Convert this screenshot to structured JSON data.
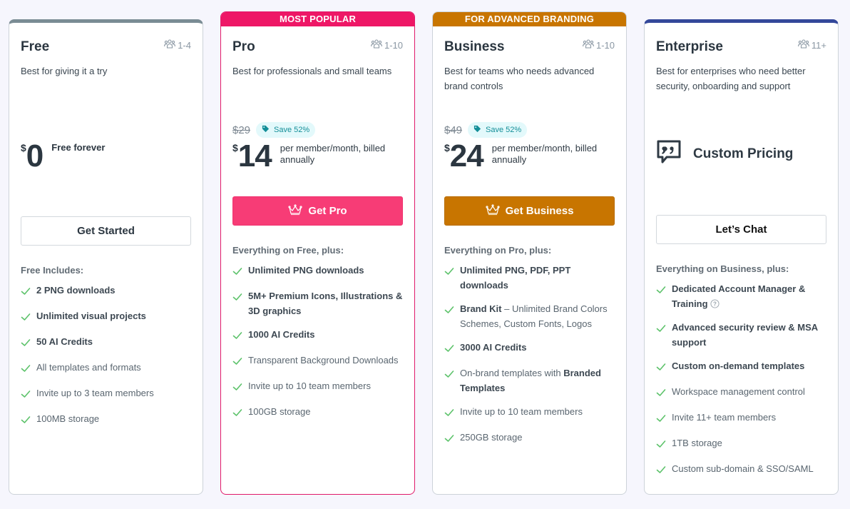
{
  "colors": {
    "page_bg": "#f6f6fd",
    "free_accent": "#7a8c94",
    "pro_accent": "#ee1766",
    "pro_button": "#f73c76",
    "business_accent": "#c87500",
    "enterprise_accent": "#34489a",
    "check": "#5cc26a",
    "save_pill_bg": "#e3f9fb",
    "save_pill_text": "#138e98"
  },
  "plans": [
    {
      "id": "free",
      "name": "Free",
      "team_icon": "team-icon",
      "team_size": "1-4",
      "description": "Best for giving it a try",
      "currency": "$",
      "amount": "0",
      "price_note": "Free forever",
      "cta": "Get Started",
      "features_title": "Free Includes:",
      "features": [
        {
          "text": "2 PNG downloads",
          "strong": true
        },
        {
          "text": "Unlimited visual projects",
          "strong": true
        },
        {
          "text": "50 AI Credits",
          "strong": true
        },
        {
          "text": "All templates and formats",
          "strong": false
        },
        {
          "text": "Invite up to 3 team members",
          "strong": false
        },
        {
          "text": "100MB storage",
          "strong": false
        }
      ]
    },
    {
      "id": "pro",
      "banner": "MOST POPULAR",
      "name": "Pro",
      "team_size": "1-10",
      "description": "Best for professionals and small teams",
      "old_price": "$29",
      "save_label": "Save 52%",
      "currency": "$",
      "amount": "14",
      "price_note": "per member/month, billed annually",
      "cta_icon": "crown-icon",
      "cta": "Get Pro",
      "features_title": "Everything on Free, plus:",
      "features": [
        {
          "text": "Unlimited PNG downloads",
          "strong": true
        },
        {
          "text": "5M+ Premium Icons, Illustrations & 3D graphics",
          "strong": true
        },
        {
          "text": "1000 AI Credits",
          "strong": true
        },
        {
          "text": "Transparent Background Downloads",
          "strong": false
        },
        {
          "text": "Invite up to 10 team members",
          "strong": false
        },
        {
          "text": "100GB storage",
          "strong": false
        }
      ]
    },
    {
      "id": "business",
      "banner": "FOR ADVANCED BRANDING",
      "name": "Business",
      "team_size": "1-10",
      "description": "Best for teams who needs advanced brand controls",
      "old_price": "$49",
      "save_label": "Save 52%",
      "currency": "$",
      "amount": "24",
      "price_note": "per member/month, billed annually",
      "cta_icon": "crown-icon",
      "cta": "Get Business",
      "features_title": "Everything on Pro, plus:",
      "features": [
        {
          "text": "Unlimited PNG, PDF, PPT downloads",
          "strong": true
        },
        {
          "bold": "Brand Kit",
          "text": " – Unlimited Brand Colors Schemes, Custom Fonts, Logos",
          "strong": false
        },
        {
          "text": "3000 AI Credits",
          "strong": true
        },
        {
          "text": "On-brand templates with ",
          "bold_after": "Branded Templates",
          "strong": false
        },
        {
          "text": "Invite up to 10 team members",
          "strong": false
        },
        {
          "text": "250GB storage",
          "strong": false
        }
      ]
    },
    {
      "id": "enterprise",
      "name": "Enterprise",
      "team_size": "11+",
      "description": "Best for enterprises who need better security, onboarding and support",
      "custom_pricing_icon": "quote-bubble-icon",
      "custom_pricing": "Custom Pricing",
      "cta": "Let’s Chat",
      "features_title": "Everything on Business, plus:",
      "features": [
        {
          "text": "Dedicated Account Manager & Training",
          "strong": true,
          "help": true
        },
        {
          "text": "Advanced security review & MSA support",
          "strong": true
        },
        {
          "text": "Custom on-demand templates",
          "strong": true
        },
        {
          "text": "Workspace management control",
          "strong": false
        },
        {
          "text": "Invite 11+ team members",
          "strong": false
        },
        {
          "text": "1TB storage",
          "strong": false
        },
        {
          "text": "Custom sub-domain & SSO/SAML",
          "strong": false
        }
      ]
    }
  ]
}
